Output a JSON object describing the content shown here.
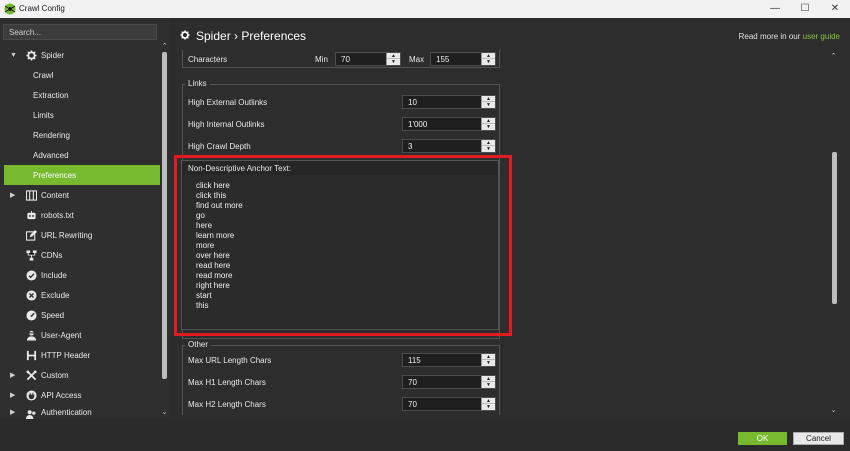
{
  "window": {
    "title": "Crawl Config"
  },
  "sidebar": {
    "search_placeholder": "Search...",
    "items": [
      {
        "label": "Spider",
        "icon": "gear-icon",
        "expanded": true
      },
      {
        "label": "Crawl"
      },
      {
        "label": "Extraction"
      },
      {
        "label": "Limits"
      },
      {
        "label": "Rendering"
      },
      {
        "label": "Advanced"
      },
      {
        "label": "Preferences",
        "selected": true
      },
      {
        "label": "Content",
        "icon": "columns-icon"
      },
      {
        "label": "robots.txt",
        "icon": "robot-icon"
      },
      {
        "label": "URL Rewriting",
        "icon": "edit-icon"
      },
      {
        "label": "CDNs",
        "icon": "network-icon"
      },
      {
        "label": "Include",
        "icon": "check-circle-icon"
      },
      {
        "label": "Exclude",
        "icon": "x-circle-icon"
      },
      {
        "label": "Speed",
        "icon": "gauge-icon"
      },
      {
        "label": "User-Agent",
        "icon": "user-agent-icon"
      },
      {
        "label": "HTTP Header",
        "icon": "header-icon"
      },
      {
        "label": "Custom",
        "icon": "tools-icon"
      },
      {
        "label": "API Access",
        "icon": "plug-icon"
      },
      {
        "label": "Authentication",
        "icon": "users-icon"
      }
    ]
  },
  "header": {
    "breadcrumb": "Spider › Preferences",
    "guide_prefix": "Read more in our ",
    "guide_link": "user guide"
  },
  "characters": {
    "label": "Characters",
    "min_label": "Min",
    "min_value": "70",
    "max_label": "Max",
    "max_value": "155"
  },
  "links": {
    "title": "Links",
    "rows": [
      {
        "label": "High External Outlinks",
        "value": "10"
      },
      {
        "label": "High Internal Outlinks",
        "value": "1'000"
      },
      {
        "label": "High Crawl Depth",
        "value": "3"
      }
    ]
  },
  "anchor_text": {
    "label": "Non-Descriptive Anchor Text:",
    "terms": [
      "click here",
      "click this",
      "find out more",
      "go",
      "here",
      "learn more",
      "more",
      "over here",
      "read here",
      "read more",
      "right here",
      "start",
      "this"
    ]
  },
  "other": {
    "title": "Other",
    "rows": [
      {
        "label": "Max URL Length Chars",
        "value": "115"
      },
      {
        "label": "Max H1 Length Chars",
        "value": "70"
      },
      {
        "label": "Max H2 Length Chars",
        "value": "70"
      }
    ]
  },
  "footer": {
    "ok_label": "OK",
    "cancel_label": "Cancel"
  },
  "colors": {
    "accent": "#77b92f",
    "highlight": "#e21b23"
  }
}
